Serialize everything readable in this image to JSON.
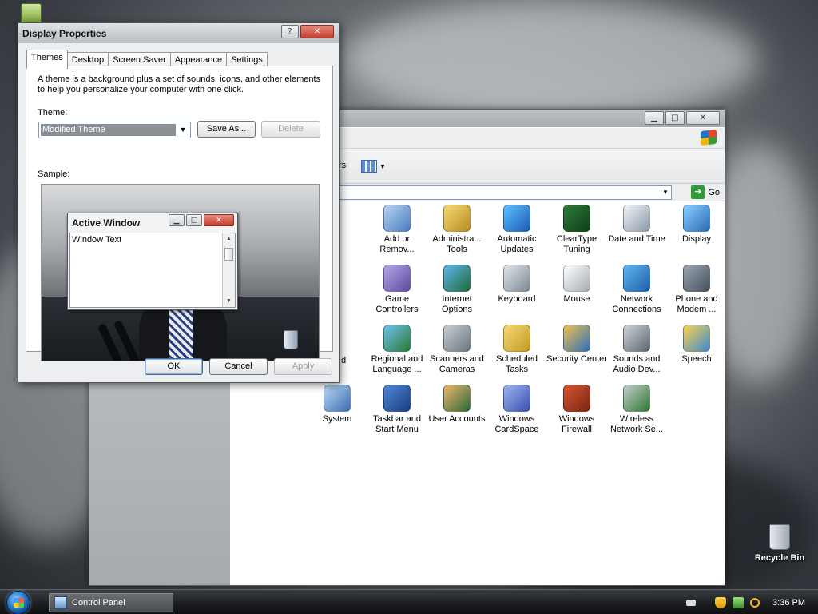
{
  "desktop": {
    "recycle_bin_label": "Recycle Bin"
  },
  "control_panel": {
    "items": [
      {
        "label": "Add or Remov...",
        "icon": "add-remove-programs-icon"
      },
      {
        "label": "Administra... Tools",
        "icon": "administrative-tools-icon"
      },
      {
        "label": "Automatic Updates",
        "icon": "automatic-updates-icon"
      },
      {
        "label": "ClearType Tuning",
        "icon": "cleartype-tuning-icon"
      },
      {
        "label": "Date and Time",
        "icon": "date-time-icon"
      },
      {
        "label": "Display",
        "icon": "display-icon"
      },
      {
        "label": "Game Controllers",
        "icon": "game-controllers-icon"
      },
      {
        "label": "Internet Options",
        "icon": "internet-options-icon"
      },
      {
        "label": "Keyboard",
        "icon": "keyboard-icon"
      },
      {
        "label": "Mouse",
        "icon": "mouse-icon"
      },
      {
        "label": "Network Connections",
        "icon": "network-connections-icon"
      },
      {
        "label": "Phone and Modem ...",
        "icon": "phone-modem-icon"
      },
      {
        "label": "Regional and Language ...",
        "icon": "regional-language-icon"
      },
      {
        "label": "Scanners and Cameras",
        "icon": "scanners-cameras-icon"
      },
      {
        "label": "Scheduled Tasks",
        "icon": "scheduled-tasks-icon"
      },
      {
        "label": "Security Center",
        "icon": "security-center-icon"
      },
      {
        "label": "Sounds and Audio Dev...",
        "icon": "sounds-audio-icon"
      },
      {
        "label": "Speech",
        "icon": "speech-icon"
      },
      {
        "label": "System",
        "icon": "system-icon"
      },
      {
        "label": "Taskbar and Start Menu",
        "icon": "taskbar-start-menu-icon"
      },
      {
        "label": "User Accounts",
        "icon": "user-accounts-icon"
      },
      {
        "label": "Windows CardSpace",
        "icon": "windows-cardspace-icon"
      },
      {
        "label": "Windows Firewall",
        "icon": "windows-firewall-icon"
      },
      {
        "label": "Wireless Network Se...",
        "icon": "wireless-network-icon"
      }
    ],
    "go_label": "Go",
    "partial_labels": {
      "toolbar_fragment": "rs",
      "left_fragment": "d"
    }
  },
  "display_properties": {
    "title": "Display Properties",
    "help_glyph": "?",
    "close_glyph": "✕",
    "tabs": [
      "Themes",
      "Desktop",
      "Screen Saver",
      "Appearance",
      "Settings"
    ],
    "active_tab": "Themes",
    "description": "A theme is a background plus a set of sounds, icons, and other elements to help you personalize your computer with one click.",
    "theme_label": "Theme:",
    "theme_value": "Modified Theme",
    "save_as_label": "Save As...",
    "delete_label": "Delete",
    "sample_label": "Sample:",
    "preview": {
      "title": "Active Window",
      "body_text": "Window Text"
    },
    "ok_label": "OK",
    "cancel_label": "Cancel",
    "apply_label": "Apply"
  },
  "taskbar": {
    "task_label": "Control Panel",
    "clock": "3:36 PM"
  },
  "colors": {
    "accent": "#2a83d6",
    "close_red": "#c5402d",
    "go_green": "#2f9a3a"
  }
}
